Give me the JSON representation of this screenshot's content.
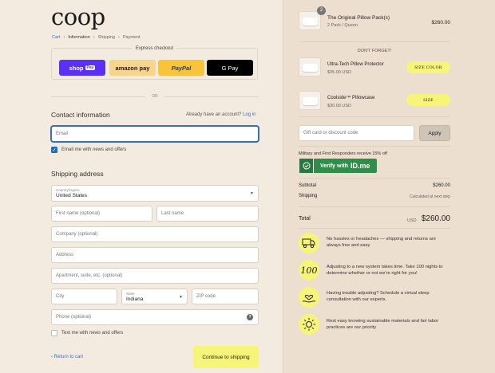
{
  "brand": "coop",
  "breadcrumb": [
    "Cart",
    "Information",
    "Shipping",
    "Payment"
  ],
  "express": {
    "title": "Express checkout",
    "buttons": [
      {
        "label": "shop",
        "sub": "Pay",
        "bg": "#5a31f4",
        "color": "#ffffff"
      },
      {
        "label": "amazon pay",
        "bg": "#f7d58a",
        "color": "#222222"
      },
      {
        "label": "PayPal",
        "bg": "#f9c43b",
        "color": "#1f3d7a"
      },
      {
        "label": "G Pay",
        "bg": "#000000",
        "color": "#ffffff"
      }
    ]
  },
  "or_text": "OR",
  "contact": {
    "heading": "Contact information",
    "account_prompt": "Already have an account?",
    "login_link": "Log in",
    "email_placeholder": "Email",
    "newsletter_label": "Email me with news and offers"
  },
  "shipping": {
    "heading": "Shipping address",
    "country_label": "Country/region",
    "country_value": "United States",
    "first_name": "First name (optional)",
    "last_name": "Last name",
    "company": "Company (optional)",
    "address": "Address",
    "apartment": "Apartment, suite, etc. (optional)",
    "city": "City",
    "state_label": "State",
    "state_value": "Indiana",
    "zip": "ZIP code",
    "phone": "Phone (optional)",
    "sms_label": "Text me with news and offers"
  },
  "footer": {
    "return_link": "‹ Return to cart",
    "continue": "Continue to shipping"
  },
  "order": {
    "item_qty": "2",
    "item_name": "The Original Pillow Pack(s)",
    "item_variant": "2 Pack / Queen",
    "item_price": "$260.00",
    "dont_forget": "DON'T FORGET!",
    "upsells": [
      {
        "name": "Ultra-Tech Pillow Protector",
        "price": "$35.00 USD",
        "button": "SIZE COLOR"
      },
      {
        "name": "Coolside™ Pillowcase",
        "price": "$30.00 USD",
        "button": "SIZE"
      }
    ],
    "gift_placeholder": "Gift card or discount code",
    "apply": "Apply",
    "military_text": "Military and First Responders receive 15% off",
    "idme_text": "Verify with",
    "idme_brand": "ID.me",
    "subtotal_label": "Subtotal",
    "subtotal_value": "$260.00",
    "shipping_label": "Shipping",
    "shipping_value": "Calculated at next step",
    "total_label": "Total",
    "currency": "USD",
    "total_value": "$260.00"
  },
  "features": [
    {
      "icon": "truck-icon",
      "text": "No hassles or headaches — shipping and returns are always free and easy"
    },
    {
      "icon": "100-icon",
      "text": "Adjusting to a new system takes time. Take 100 nights to determine whether or not we're right for you!"
    },
    {
      "icon": "hand-heart-icon",
      "text": "Having trouble adjusting? Schedule a virtual sleep consultation with our experts."
    },
    {
      "icon": "sun-icon",
      "text": "Rest easy knowing sustainable materials and fair labor practices are our priority"
    }
  ]
}
